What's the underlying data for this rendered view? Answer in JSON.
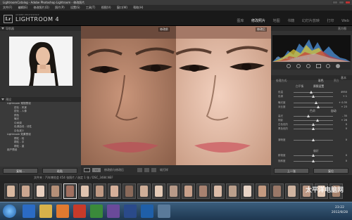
{
  "window": {
    "title": "LightroomCatalog - Adobe Photoshop Lightroom - 修改照片"
  },
  "menu": [
    "文件(F)",
    "编辑(E)",
    "修改照片(D)",
    "照片(P)",
    "设置(S)",
    "工具(T)",
    "视图(V)",
    "窗口(W)",
    "帮助(H)"
  ],
  "identity": {
    "small": "ADOBE PHOTOSHOP",
    "name": "LIGHTROOM 4"
  },
  "modules": [
    {
      "label": "图库",
      "active": false
    },
    {
      "label": "修改照片",
      "active": true
    },
    {
      "label": "地图",
      "active": false
    },
    {
      "label": "书籍",
      "active": false
    },
    {
      "label": "幻灯片放映",
      "active": false
    },
    {
      "label": "打印",
      "active": false
    },
    {
      "label": "Web",
      "active": false
    }
  ],
  "left_panel": {
    "navigator_label": "导航器",
    "presets_label": "预设",
    "presets": [
      {
        "label": "Lightroom 常规预设",
        "group": true
      },
      {
        "label": "锐化 - 风景",
        "group": false
      },
      {
        "label": "锐化 - 人像",
        "group": false
      },
      {
        "label": "颜色",
        "group": false
      },
      {
        "label": "曝光",
        "group": false
      },
      {
        "label": "中间调",
        "group": false
      },
      {
        "label": "色调曲线 - 线性",
        "group": false
      },
      {
        "label": "杂色减少",
        "group": false
      },
      {
        "label": "Lightroom 效果预设",
        "group": true
      },
      {
        "label": "颗粒 - 轻",
        "group": false
      },
      {
        "label": "颗粒 - 中",
        "group": false
      },
      {
        "label": "颗粒 - 重",
        "group": false
      },
      {
        "label": "用户预设",
        "group": true
      }
    ],
    "copy_button": "复制...",
    "paste_button": "粘贴"
  },
  "compare": {
    "before_label": "修改前",
    "after_label": "修改后"
  },
  "toolbar": {
    "label": "修改前与修改后",
    "info": "软打样"
  },
  "right_panel": {
    "histogram_label": "直方图",
    "histo_info": "ISO 200   85 mm   f/5.6   1/160 秒",
    "basic_label": "基本",
    "treatment": "处理方式:",
    "treatment_options": [
      "彩色",
      "黑白"
    ],
    "wb_label": "白平衡",
    "wb_value": "原照设置",
    "sliders": [
      {
        "label": "色温",
        "value": "4950"
      },
      {
        "label": "色调",
        "value": "+ 1"
      },
      {
        "label": "曝光度",
        "value": "+ 0.35"
      },
      {
        "label": "对比度",
        "value": "+ 23"
      },
      {
        "label": "高光",
        "value": "- 35"
      },
      {
        "label": "阴影",
        "value": "+ 26"
      },
      {
        "label": "白色色阶",
        "value": "0"
      },
      {
        "label": "黑色色阶",
        "value": "0"
      },
      {
        "label": "清晰度",
        "value": "0"
      },
      {
        "label": "鲜艳度",
        "value": "0"
      },
      {
        "label": "饱和度",
        "value": "0"
      }
    ],
    "tone_label": "色调",
    "tone_value": "自动",
    "presence_label": "偏好",
    "prev_button": "上一张",
    "reset_button": "复位"
  },
  "filmstrip": {
    "info": "文件夹 : 汽车博览会    454 张照片 / 选定 1 张 / DSC_3484.NEF"
  },
  "taskbar": {
    "time": "23:22",
    "date": "2012/8/28"
  },
  "watermark": "太平洋电脑网"
}
